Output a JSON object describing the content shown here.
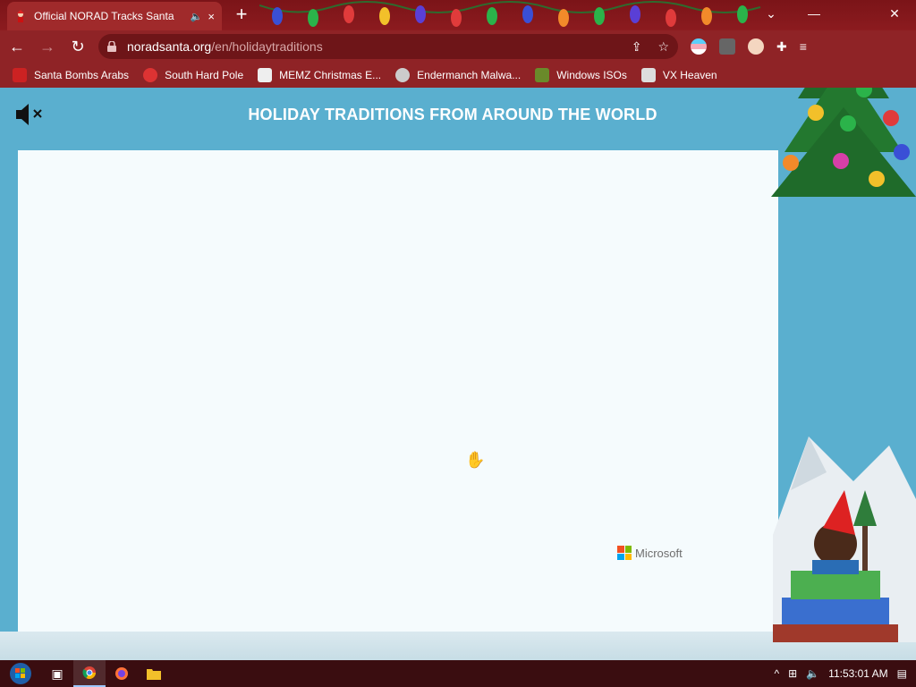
{
  "browser": {
    "tab": {
      "title": "Official NORAD Tracks Santa",
      "audio_icon": "speaker-icon",
      "close": "×"
    },
    "new_tab": "+",
    "window_controls": {
      "tabsearch": "⌄",
      "minimize": "—",
      "close": "✕"
    },
    "nav": {
      "back": "←",
      "forward": "→",
      "reload": "↻"
    },
    "address": {
      "host": "noradsanta.org",
      "path": "/en/holidaytraditions"
    },
    "bookmarks": [
      {
        "label": "Santa Bombs Arabs",
        "icon_color": "#c22"
      },
      {
        "label": "South Hard Pole",
        "icon_color": "#d33"
      },
      {
        "label": "MEMZ Christmas E...",
        "icon_color": "#eee"
      },
      {
        "label": "Endermanch Malwa...",
        "icon_color": "#ccc"
      },
      {
        "label": "Windows ISOs",
        "icon_color": "#6a8a2a"
      },
      {
        "label": "VX Heaven",
        "icon_color": "#ddd"
      }
    ]
  },
  "page": {
    "title": "HOLIDAY TRADITIONS FROM AROUND THE WORLD",
    "sponsor": "Microsoft"
  },
  "taskbar": {
    "time": "11:53:01 AM"
  },
  "colors": {
    "frame": "#8f2326",
    "page_bg": "#5aafcf",
    "panel": "#f5fbfd"
  }
}
